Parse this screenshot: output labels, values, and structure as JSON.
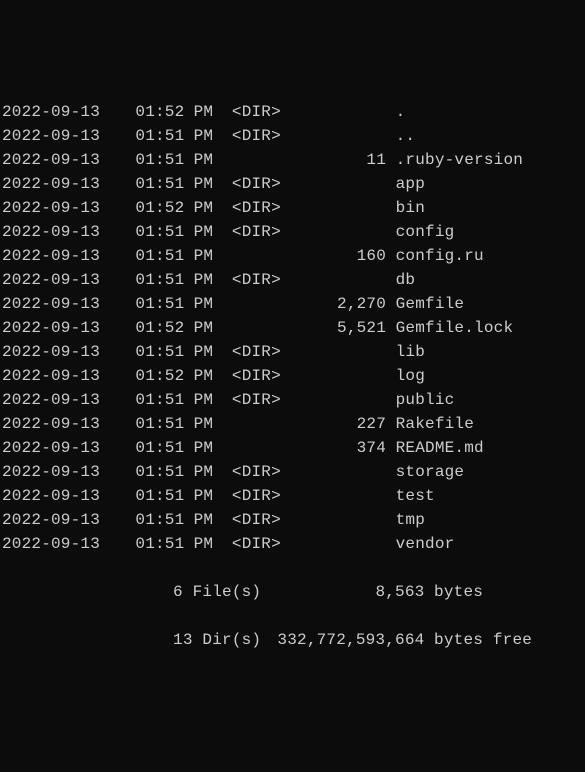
{
  "entries": [
    {
      "date": "2022-09-13",
      "time": "01:52",
      "ampm": "PM",
      "dir": "<DIR>",
      "size": "",
      "name": "."
    },
    {
      "date": "2022-09-13",
      "time": "01:51",
      "ampm": "PM",
      "dir": "<DIR>",
      "size": "",
      "name": ".."
    },
    {
      "date": "2022-09-13",
      "time": "01:51",
      "ampm": "PM",
      "dir": "",
      "size": "11",
      "name": ".ruby-version"
    },
    {
      "date": "2022-09-13",
      "time": "01:51",
      "ampm": "PM",
      "dir": "<DIR>",
      "size": "",
      "name": "app"
    },
    {
      "date": "2022-09-13",
      "time": "01:52",
      "ampm": "PM",
      "dir": "<DIR>",
      "size": "",
      "name": "bin"
    },
    {
      "date": "2022-09-13",
      "time": "01:51",
      "ampm": "PM",
      "dir": "<DIR>",
      "size": "",
      "name": "config"
    },
    {
      "date": "2022-09-13",
      "time": "01:51",
      "ampm": "PM",
      "dir": "",
      "size": "160",
      "name": "config.ru"
    },
    {
      "date": "2022-09-13",
      "time": "01:51",
      "ampm": "PM",
      "dir": "<DIR>",
      "size": "",
      "name": "db"
    },
    {
      "date": "2022-09-13",
      "time": "01:51",
      "ampm": "PM",
      "dir": "",
      "size": "2,270",
      "name": "Gemfile"
    },
    {
      "date": "2022-09-13",
      "time": "01:52",
      "ampm": "PM",
      "dir": "",
      "size": "5,521",
      "name": "Gemfile.lock"
    },
    {
      "date": "2022-09-13",
      "time": "01:51",
      "ampm": "PM",
      "dir": "<DIR>",
      "size": "",
      "name": "lib"
    },
    {
      "date": "2022-09-13",
      "time": "01:52",
      "ampm": "PM",
      "dir": "<DIR>",
      "size": "",
      "name": "log"
    },
    {
      "date": "2022-09-13",
      "time": "01:51",
      "ampm": "PM",
      "dir": "<DIR>",
      "size": "",
      "name": "public"
    },
    {
      "date": "2022-09-13",
      "time": "01:51",
      "ampm": "PM",
      "dir": "",
      "size": "227",
      "name": "Rakefile"
    },
    {
      "date": "2022-09-13",
      "time": "01:51",
      "ampm": "PM",
      "dir": "",
      "size": "374",
      "name": "README.md"
    },
    {
      "date": "2022-09-13",
      "time": "01:51",
      "ampm": "PM",
      "dir": "<DIR>",
      "size": "",
      "name": "storage"
    },
    {
      "date": "2022-09-13",
      "time": "01:51",
      "ampm": "PM",
      "dir": "<DIR>",
      "size": "",
      "name": "test"
    },
    {
      "date": "2022-09-13",
      "time": "01:51",
      "ampm": "PM",
      "dir": "<DIR>",
      "size": "",
      "name": "tmp"
    },
    {
      "date": "2022-09-13",
      "time": "01:51",
      "ampm": "PM",
      "dir": "<DIR>",
      "size": "",
      "name": "vendor"
    }
  ],
  "summary": {
    "files_label": "6 File(s)",
    "files_bytes": "8,563",
    "files_unit": "bytes",
    "dirs_label": "13 Dir(s)",
    "dirs_bytes": "332,772,593,664",
    "dirs_unit": "bytes free"
  }
}
